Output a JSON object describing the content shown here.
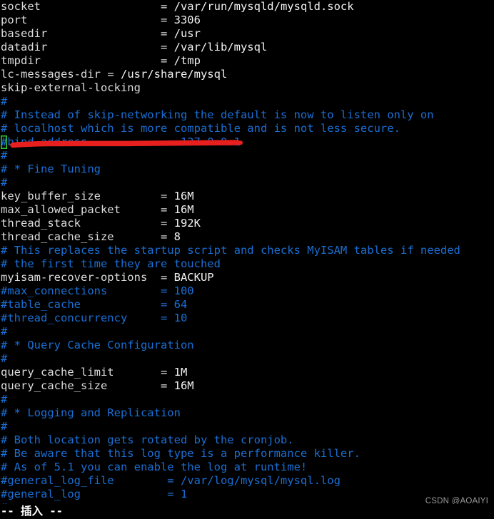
{
  "terminal": {
    "app": "vim",
    "background_color": "#000000",
    "foreground_color": "#d8d8d8",
    "comment_color": "#1a6fd4",
    "cursor_color": "#2ecc2e",
    "annotation_color": "#e81f1f",
    "columns": 76,
    "rows": 38
  },
  "file": {
    "lines": [
      {
        "id": 1,
        "indent": 0,
        "segments": [
          {
            "text": "socket",
            "cls": "c-key"
          },
          {
            "text": "                  = ",
            "cls": "c-plain"
          },
          {
            "text": "/var/run/mysqld/mysqld.sock",
            "cls": "c-val"
          }
        ]
      },
      {
        "id": 2,
        "indent": 0,
        "segments": [
          {
            "text": "port",
            "cls": "c-key"
          },
          {
            "text": "                    = ",
            "cls": "c-plain"
          },
          {
            "text": "3306",
            "cls": "c-val"
          }
        ]
      },
      {
        "id": 3,
        "indent": 0,
        "segments": [
          {
            "text": "basedir",
            "cls": "c-key"
          },
          {
            "text": "                 = ",
            "cls": "c-plain"
          },
          {
            "text": "/usr",
            "cls": "c-val"
          }
        ]
      },
      {
        "id": 4,
        "indent": 0,
        "segments": [
          {
            "text": "datadir",
            "cls": "c-key"
          },
          {
            "text": "                 = ",
            "cls": "c-plain"
          },
          {
            "text": "/var/lib/mysql",
            "cls": "c-val"
          }
        ]
      },
      {
        "id": 5,
        "indent": 0,
        "segments": [
          {
            "text": "tmpdir",
            "cls": "c-key"
          },
          {
            "text": "                  = ",
            "cls": "c-plain"
          },
          {
            "text": "/tmp",
            "cls": "c-val"
          }
        ]
      },
      {
        "id": 6,
        "indent": 0,
        "segments": [
          {
            "text": "lc-messages-dir",
            "cls": "c-key"
          },
          {
            "text": " = ",
            "cls": "c-plain"
          },
          {
            "text": "/usr/share/mysql",
            "cls": "c-val"
          }
        ]
      },
      {
        "id": 7,
        "indent": 0,
        "segments": [
          {
            "text": "skip-external-locking",
            "cls": "c-key"
          }
        ]
      },
      {
        "id": 8,
        "indent": 0,
        "segments": [
          {
            "text": "#",
            "cls": "c-comment"
          }
        ]
      },
      {
        "id": 9,
        "indent": 0,
        "segments": [
          {
            "text": "# Instead of skip-networking the default is now to listen only on",
            "cls": "c-comment"
          }
        ]
      },
      {
        "id": 10,
        "indent": 0,
        "segments": [
          {
            "text": "# localhost which is more compatible and is not less secure.",
            "cls": "c-comment"
          }
        ]
      },
      {
        "id": 11,
        "indent": 0,
        "cursor_at": 0,
        "segments": [
          {
            "text": "#",
            "cls": "c-comment cursor"
          },
          {
            "text": "bind-address            = 127.0.0.1",
            "cls": "c-comment"
          }
        ]
      },
      {
        "id": 12,
        "indent": 0,
        "segments": [
          {
            "text": "#",
            "cls": "c-comment"
          }
        ]
      },
      {
        "id": 13,
        "indent": 0,
        "segments": [
          {
            "text": "# * Fine Tuning",
            "cls": "c-comment"
          }
        ]
      },
      {
        "id": 14,
        "indent": 0,
        "segments": [
          {
            "text": "#",
            "cls": "c-comment"
          }
        ]
      },
      {
        "id": 15,
        "indent": 0,
        "segments": [
          {
            "text": "key_buffer_size",
            "cls": "c-key"
          },
          {
            "text": "         = ",
            "cls": "c-plain"
          },
          {
            "text": "16M",
            "cls": "c-val"
          }
        ]
      },
      {
        "id": 16,
        "indent": 0,
        "segments": [
          {
            "text": "max_allowed_packet",
            "cls": "c-key"
          },
          {
            "text": "      = ",
            "cls": "c-plain"
          },
          {
            "text": "16M",
            "cls": "c-val"
          }
        ]
      },
      {
        "id": 17,
        "indent": 0,
        "segments": [
          {
            "text": "thread_stack",
            "cls": "c-key"
          },
          {
            "text": "            = ",
            "cls": "c-plain"
          },
          {
            "text": "192K",
            "cls": "c-val"
          }
        ]
      },
      {
        "id": 18,
        "indent": 0,
        "segments": [
          {
            "text": "thread_cache_size",
            "cls": "c-key"
          },
          {
            "text": "       = ",
            "cls": "c-plain"
          },
          {
            "text": "8",
            "cls": "c-val"
          }
        ]
      },
      {
        "id": 19,
        "indent": 0,
        "segments": [
          {
            "text": "# This replaces the startup script and checks MyISAM tables if needed",
            "cls": "c-comment"
          }
        ]
      },
      {
        "id": 20,
        "indent": 0,
        "segments": [
          {
            "text": "# the first time they are touched",
            "cls": "c-comment"
          }
        ]
      },
      {
        "id": 21,
        "indent": 0,
        "segments": [
          {
            "text": "myisam-recover-options",
            "cls": "c-key"
          },
          {
            "text": "  = ",
            "cls": "c-plain"
          },
          {
            "text": "BACKUP",
            "cls": "c-val"
          }
        ]
      },
      {
        "id": 22,
        "indent": 0,
        "segments": [
          {
            "text": "#max_connections        = 100",
            "cls": "c-comment"
          }
        ]
      },
      {
        "id": 23,
        "indent": 0,
        "segments": [
          {
            "text": "#table_cache            = 64",
            "cls": "c-comment"
          }
        ]
      },
      {
        "id": 24,
        "indent": 0,
        "segments": [
          {
            "text": "#thread_concurrency     = 10",
            "cls": "c-comment"
          }
        ]
      },
      {
        "id": 25,
        "indent": 0,
        "segments": [
          {
            "text": "#",
            "cls": "c-comment"
          }
        ]
      },
      {
        "id": 26,
        "indent": 0,
        "segments": [
          {
            "text": "# * Query Cache Configuration",
            "cls": "c-comment"
          }
        ]
      },
      {
        "id": 27,
        "indent": 0,
        "segments": [
          {
            "text": "#",
            "cls": "c-comment"
          }
        ]
      },
      {
        "id": 28,
        "indent": 0,
        "segments": [
          {
            "text": "query_cache_limit",
            "cls": "c-key"
          },
          {
            "text": "       = ",
            "cls": "c-plain"
          },
          {
            "text": "1M",
            "cls": "c-val"
          }
        ]
      },
      {
        "id": 29,
        "indent": 0,
        "segments": [
          {
            "text": "query_cache_size",
            "cls": "c-key"
          },
          {
            "text": "        = ",
            "cls": "c-plain"
          },
          {
            "text": "16M",
            "cls": "c-val"
          }
        ]
      },
      {
        "id": 30,
        "indent": 0,
        "segments": [
          {
            "text": "#",
            "cls": "c-comment"
          }
        ]
      },
      {
        "id": 31,
        "indent": 0,
        "segments": [
          {
            "text": "# * Logging and Replication",
            "cls": "c-comment"
          }
        ]
      },
      {
        "id": 32,
        "indent": 0,
        "segments": [
          {
            "text": "#",
            "cls": "c-comment"
          }
        ]
      },
      {
        "id": 33,
        "indent": 0,
        "segments": [
          {
            "text": "# Both location gets rotated by the cronjob.",
            "cls": "c-comment"
          }
        ]
      },
      {
        "id": 34,
        "indent": 0,
        "segments": [
          {
            "text": "# Be aware that this log type is a performance killer.",
            "cls": "c-comment"
          }
        ]
      },
      {
        "id": 35,
        "indent": 0,
        "segments": [
          {
            "text": "# As of 5.1 you can enable the log at runtime!",
            "cls": "c-comment"
          }
        ]
      },
      {
        "id": 36,
        "indent": 0,
        "segments": [
          {
            "text": "#general_log_file        = /var/log/mysql/mysql.log",
            "cls": "c-comment"
          }
        ]
      },
      {
        "id": 37,
        "indent": 0,
        "segments": [
          {
            "text": "#general_log             = 1",
            "cls": "c-comment"
          }
        ]
      },
      {
        "id": 38,
        "indent": 0,
        "segments": [
          {
            "text": "#",
            "cls": "c-comment"
          }
        ]
      }
    ]
  },
  "statusline": {
    "mode_text": "-- 插入 --"
  },
  "annotation": {
    "type": "red-underline",
    "target_line": "#bind-address            = 127.0.0.1",
    "color": "#e81f1f"
  },
  "watermark": {
    "text": "CSDN @AOAIYI"
  }
}
